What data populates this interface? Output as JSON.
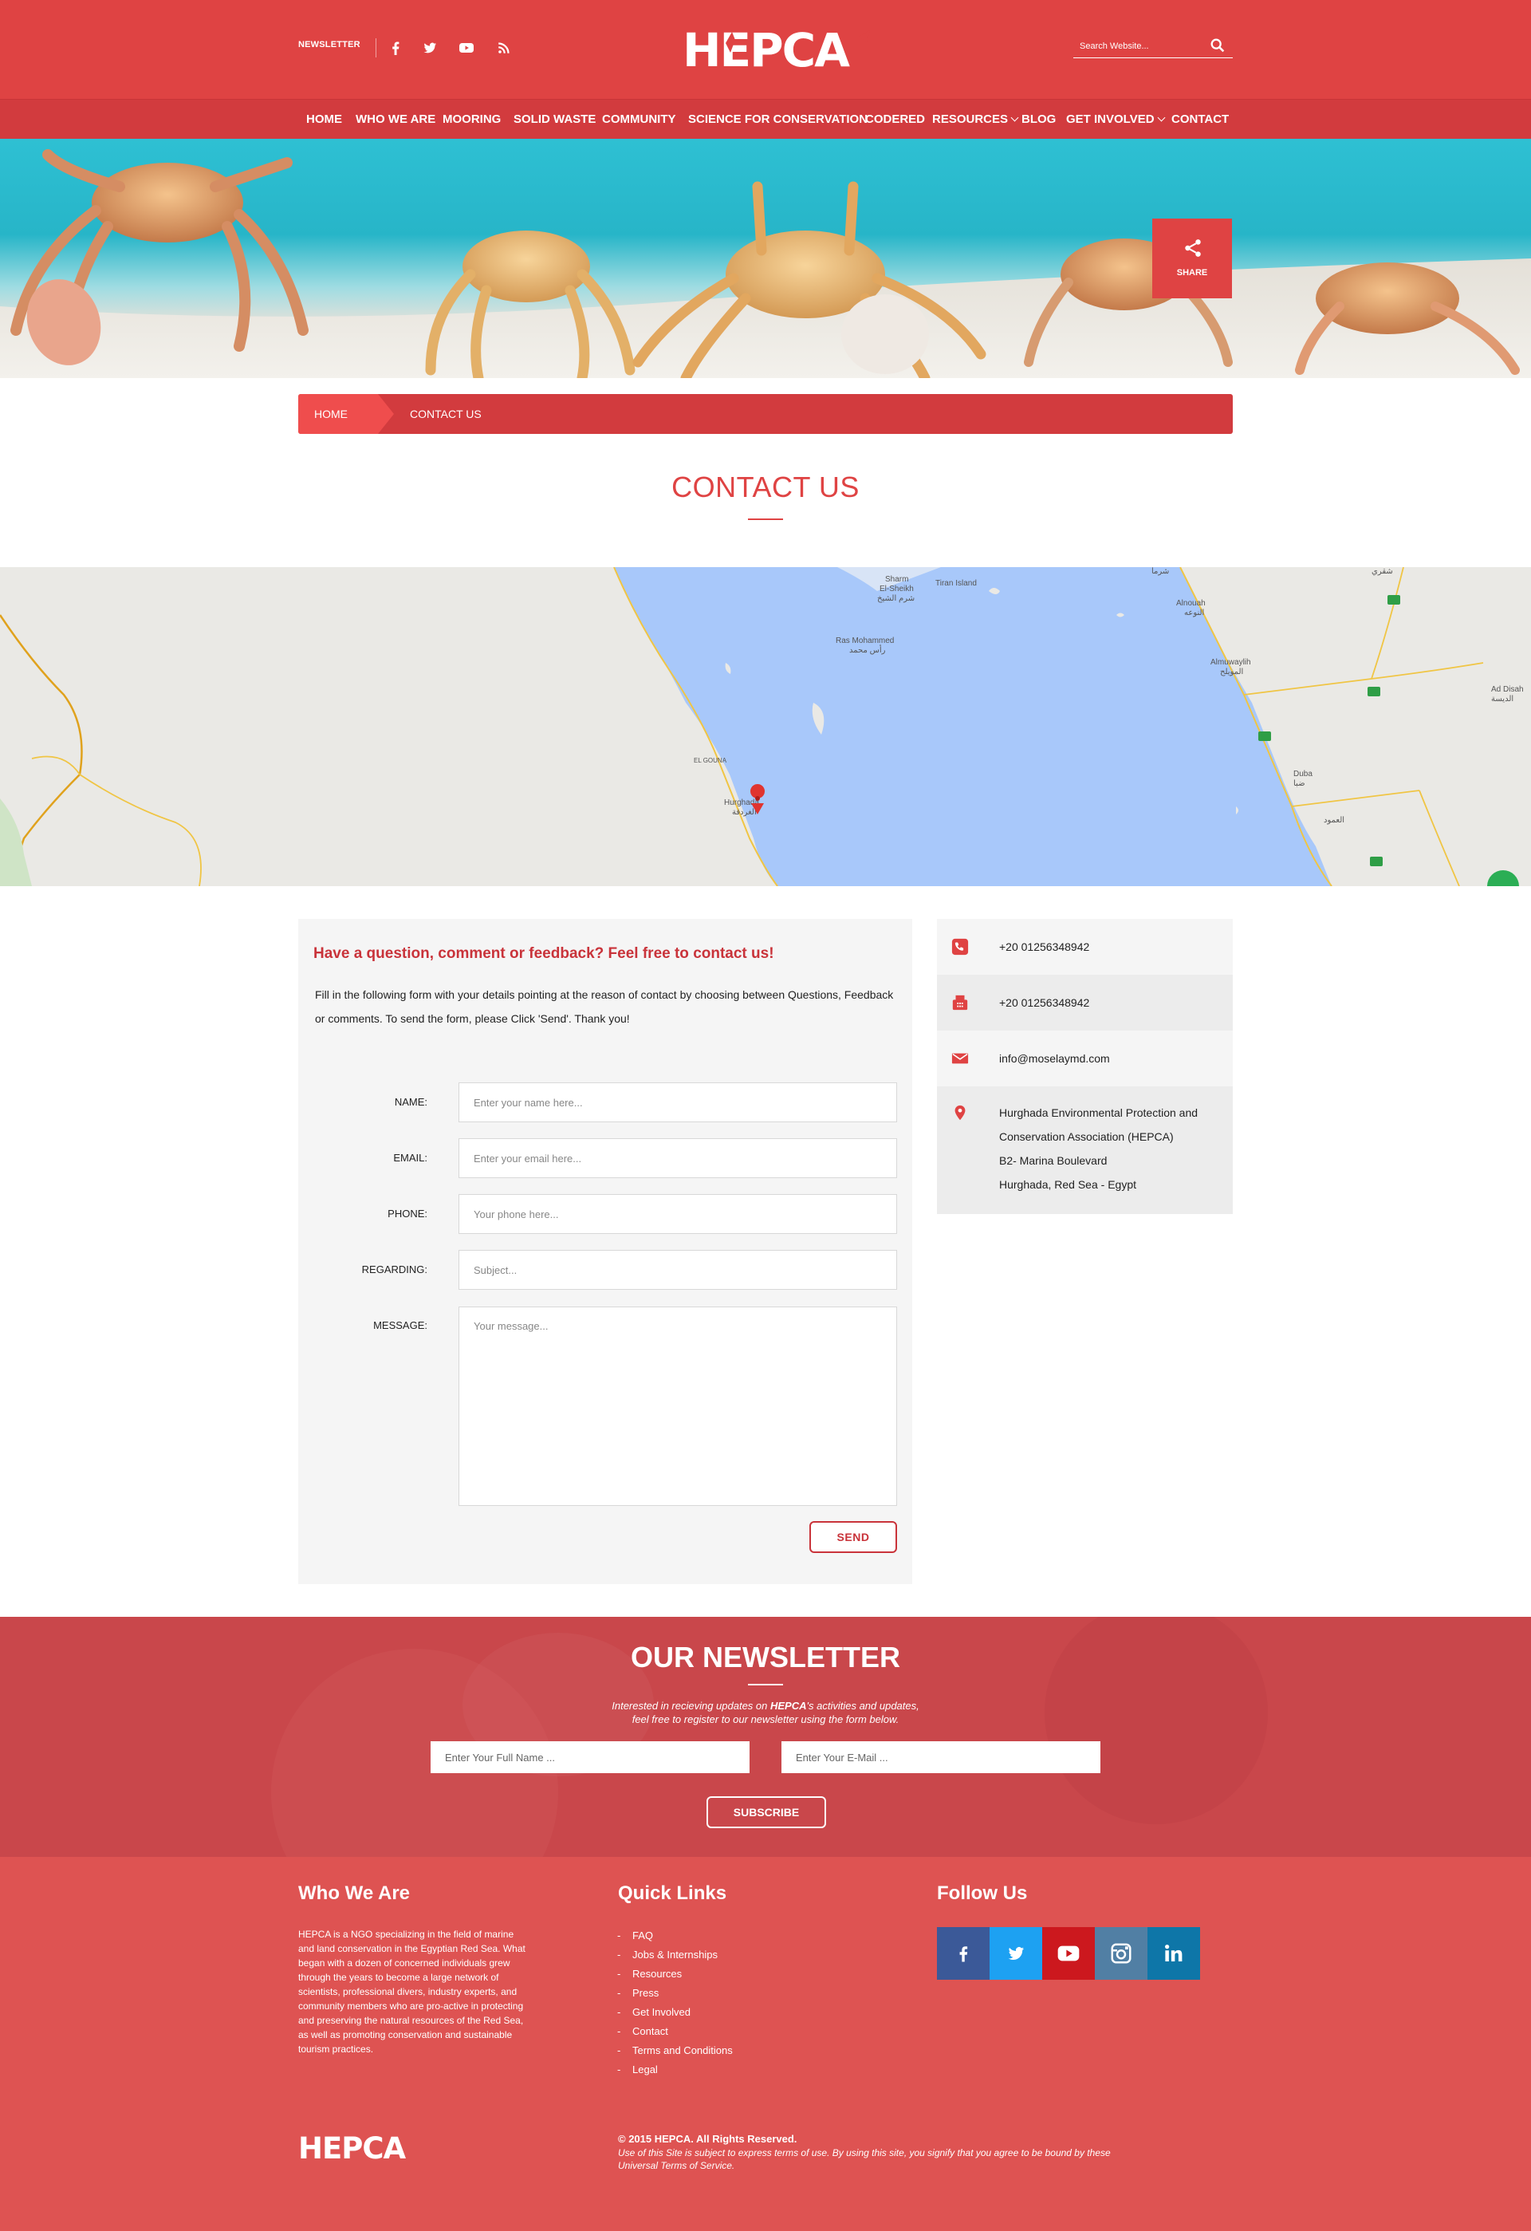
{
  "header": {
    "newsletter_link": "NEWSLETTER",
    "logo_text": "HEPCA",
    "search_placeholder": "Search Website...",
    "social_icons": [
      "facebook-icon",
      "twitter-icon",
      "youtube-icon",
      "rss-icon"
    ]
  },
  "nav": {
    "items": [
      {
        "label": "HOME"
      },
      {
        "label": "WHO WE ARE"
      },
      {
        "label": "MOORING"
      },
      {
        "label": "SOLID WASTE"
      },
      {
        "label": "COMMUNITY"
      },
      {
        "label": "SCIENCE FOR CONSERVATION"
      },
      {
        "label": "CODERED"
      },
      {
        "label": "RESOURCES",
        "dropdown": true
      },
      {
        "label": "BLOG"
      },
      {
        "label": "GET INVOLVED",
        "dropdown": true
      },
      {
        "label": "CONTACT"
      }
    ]
  },
  "hero": {
    "share_label": "SHARE"
  },
  "breadcrumb": {
    "home": "HOME",
    "current": "CONTACT US"
  },
  "page": {
    "title": "CONTACT US"
  },
  "map": {
    "places": [
      {
        "name": "Sharm El-Sheikh",
        "alt": "شرم الشيخ"
      },
      {
        "name": "Tiran Island"
      },
      {
        "name": "Ras Mohammed",
        "alt": "رأس محمد"
      },
      {
        "name": "Hurghada",
        "alt": "الغردقة"
      },
      {
        "name": "EL GOUNA"
      },
      {
        "name": "Alnouah",
        "alt": "النوعه"
      },
      {
        "name": "Almuwaylih",
        "alt": "المويلح"
      },
      {
        "name": "Ad Disah",
        "alt": "الديسة"
      },
      {
        "name": "Duba",
        "alt": "ضبا"
      },
      {
        "name": "شرما"
      },
      {
        "name": "شقري"
      },
      {
        "name": "العمود"
      }
    ]
  },
  "form": {
    "heading": "Have a question, comment or feedback? Feel free to contact us!",
    "intro": "Fill in the following form with your details pointing at the reason of contact by choosing between Questions, Feedback or comments. To send the form, please Click 'Send'. Thank you!",
    "fields": [
      {
        "label": "NAME:",
        "placeholder": "Enter your name here..."
      },
      {
        "label": "EMAIL:",
        "placeholder": "Enter your email here..."
      },
      {
        "label": "PHONE:",
        "placeholder": "Your phone here..."
      },
      {
        "label": "REGARDING:",
        "placeholder": "Subject..."
      },
      {
        "label": "MESSAGE:",
        "placeholder": "Your message..."
      }
    ],
    "send_label": "SEND"
  },
  "contact_info": {
    "phone": "+20 01256348942",
    "fax": "+20 01256348942",
    "email": "info@moselaymd.com",
    "address": [
      "Hurghada Environmental Protection and",
      "Conservation Association (HEPCA)",
      "B2- Marina Boulevard",
      "Hurghada, Red Sea - Egypt"
    ]
  },
  "newsletter": {
    "title": "OUR NEWSLETTER",
    "desc_1": "Interested in recieving updates on ",
    "desc_brand": "HEPCA",
    "desc_2": "'s activities and updates,",
    "desc_3": "feel free to register to our newsletter using the form below.",
    "name_placeholder": "Enter Your Full Name ...",
    "email_placeholder": "Enter Your E-Mail ...",
    "subscribe_label": "SUBSCRIBE"
  },
  "footer": {
    "who_title": "Who We Are",
    "who_text": "HEPCA is a NGO specializing in the field of marine and land conservation in the Egyptian Red Sea. What began with a dozen of concerned individuals grew through the years to become a large network of scientists, professional divers, industry experts, and community members who are pro-active in protecting and preserving the natural resources of the Red Sea, as well as promoting conservation and sustainable tourism practices.",
    "links_title": "Quick Links",
    "links": [
      "FAQ",
      "Jobs & Internships",
      "Resources",
      "Press",
      "Get Involved",
      "Contact",
      "Terms and Conditions",
      "Legal"
    ],
    "follow_title": "Follow Us",
    "social": [
      {
        "icon": "facebook-icon",
        "color": "#3b5998"
      },
      {
        "icon": "twitter-icon",
        "color": "#1da1f2"
      },
      {
        "icon": "youtube-icon",
        "color": "#cc181e"
      },
      {
        "icon": "instagram-icon",
        "color": "#517fa4"
      },
      {
        "icon": "linkedin-icon",
        "color": "#0e76a8"
      }
    ],
    "logo_text": "HEPCA",
    "copyright": "© 2015 HEPCA. All Rights Reserved.",
    "terms": "Use of this Site is subject to express terms of use. By using this site, you signify that you agree to be bound by these Universal Terms of Service."
  },
  "colors": {
    "brand": "#df4343",
    "nav": "#d23b3e",
    "sea": "#a8c8fa",
    "footer": "#de5352"
  }
}
